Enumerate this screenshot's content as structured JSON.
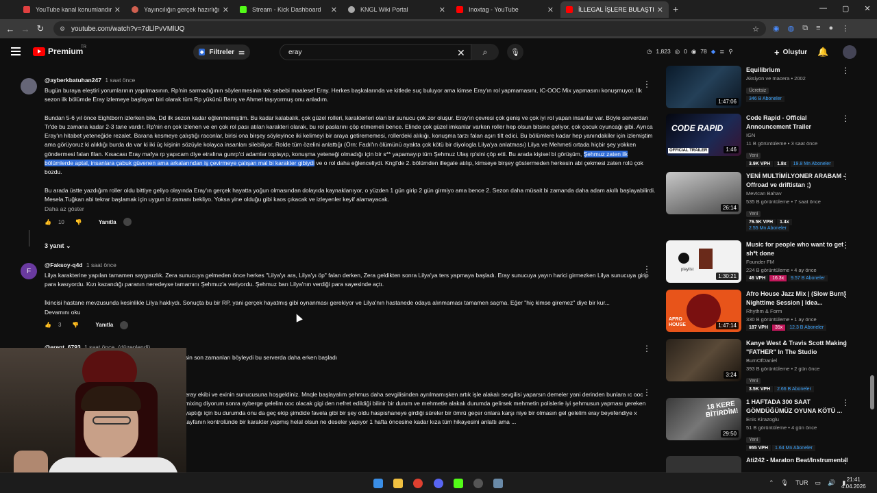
{
  "browser": {
    "tabs": [
      {
        "title": "YouTube kanal konumlandırma",
        "color": "#e04040"
      },
      {
        "title": "Yayıncılığın gerçek hazırlığı - Cl",
        "color": "#d06050"
      },
      {
        "title": "Stream - Kick Dashboard",
        "color": "#53fc18"
      },
      {
        "title": "KNGL Wiki Portal",
        "color": "#aaaaaa"
      },
      {
        "title": "Inoxtag - YouTube",
        "color": "#ff0000"
      },
      {
        "title": "İLLEGAL İŞLERE BULAŞTIK! POLİ",
        "color": "#ff0000"
      }
    ],
    "url": "youtube.com/watch?v=7dLlPvVMlUQ"
  },
  "header": {
    "logo": "Premium",
    "region": "TR",
    "filters_label": "Filtreler",
    "search_value": "eray",
    "stats": [
      "1,823",
      "0",
      "78"
    ],
    "create_label": "Oluştur"
  },
  "comments": [
    {
      "avatar": "",
      "author": "@ayberkbatuhan247",
      "time": "1 saat önce",
      "p1": "Bugün buraya eleştiri yorumlarının yapılmasının, Rp'nin sarmadığının söylenmesinin tek sebebi maalesef Eray. Herkes başkalarında ve kitlede suç buluyor ama kimse Eray'ın rol yapmamasını, IC-OOC Mix yapmasını konuşmuyor. İlk sezon ilk bölümde Eray izlemeye başlayan biri olarak tüm Rp yükünü Barış ve Ahmet taşıyormuş onu anladım.",
      "p2a": "Bundan 5-6 yıl önce Eightborn izlerken bile, Dd ilk sezon kadar eğlenmemiştim. Bu kadar kalabalık, çok güzel rolleri, karakterleri olan bir sunucu çok zor oluşur. Eray'ın çevresi çok geniş ve çok iyi rol yapan insanlar var. Böyle serverdan Tr'de bu zamana kadar 2-3 tane vardır. Rp'nin en çok izlenen ve en çok rol pası atılan karakteri olarak, bu rol paslarını çöp etmemeli bence. Elinde çok güzel imkanlar varken roller hep olsun bitsine geliyor, çok çocuk oyuncağı gibi. Ayrıca Eray'ın hitabet yeteneğide rezalet. Barana kesmeye çalıştığı raconlar, birisi ona birşey söyleyince iki kelimeyi bir araya getirememesi, rollerdeki alıkığı, konuşma tarzı falan aşırı tilt edici. Bu bölümlere kadar hep yanındakiler için izlemiştim ama görüyoruz ki alıklığı burda da var ki iki üç kişinin sözüyle kolayca insanları silebiliyor. Rolde tüm özelini anlattığı (Örn: Fadıl'ın ölümünü ayakta çok kötü bir diyologla Lilya'ya anlatması) Lilya ve Mehmeti ortada hiçbir şey yokken göndermesi falan filan. Kısacası Eray mafya rp yapıcam diye etrafına gunrp'ci adamlar toplayıp, konuşma yeteneği olmadığı için bir s** yapamayıp tüm Şehmuz Ulaş rp'sini çöp etti. Bu arada kişisel bi görüşüm, ",
      "p2hl": "Şehmuz zaten ilk bölümlerde aptal, insanlara çabuk güvenen ama arkalarından iş çevirmeye çalışan mal bi karakter gibiydi",
      "p2b": " ve o rol daha eğlenceliydi. Kngl'de 2. bölümden illegale atılıp, kimseye birşey göstermeden herkesin abi çekmesi zaten rolü çok bozdu.",
      "p3": "Bu arada üstte yazdığım roller oldu bittiye geliyo olayında Eray'ın gerçek hayatta yoğun olmasından dolayıda kaynaklanıyor, o yüzden 1 gün girip 2 gün girmiyo ama bence 2. Sezon daha müsait bi zamanda daha adam akıllı başlayabilirdi. Mesela.Tuğkan abi tekrar başlamak için uygun bi zamanı bekliyo. Yoksa yine olduğu gibi kaos çıkacak ve izleyenler keyif alamayacak.",
      "more": "Daha az göster",
      "likes": "10",
      "reply": "Yanıtla",
      "replies": "3 yanıt"
    },
    {
      "avatar": "F",
      "author": "@Faksoy-q4d",
      "time": "1 saat önce",
      "p1": "Lilya karakterine yapılan tamamen saygısızlık. Zera sunucuya gelmeden önce herkes \"Lilya'yı ara, Lilya'yı öp\" falan derken, Zera geldikten sonra Lilya'ya ters yapmaya başladı. Eray sunucuya yayın harici girmezken Lilya sunucuya girip para kasıyordu. Kızı kazandığı paranın neredeyse tamamını Şehmuz'a veriyordu. Şehmuz barı Lilya'nın verdiği para sayesinde açtı.",
      "p2": "İkincisi hastane mevzusunda kesinlikle Lilya haklıydı. Sonuçta bu bir RP, yani gerçek hayatmış gibi oynanması gerekiyor ve Lilya'nın hastanede odaya alınmaması tamamen saçma. Eğer \"hiç kimse giremez\" diye bir kur...",
      "more": "Devamını oku",
      "likes": "3",
      "reply": "Yanıtla"
    },
    {
      "author": "@erent_6793",
      "time": "1 saat önce",
      "edited": "(düzenlendi)",
      "text": "sin son zamanları böyleydi bu serverda daha erken başladı"
    },
    {
      "text": "eray ekibi ve exinin sunucusuna hoşgeldiniz. Mnqle başlayalım şehmus daha sevgilisinden ayrılmamışken artık işle alakalı sevgilisi yaparsın demeler yani derinden bunlara ıc ooc mixing diyorum sonra ayberge gelelim ooc olacak gigi den nefret edildiği bilinir bir durum ve mehmetle alakalı durumda gelirsek mehmetin polislerle iyi şehmusun yapması gereken yaptığı için bu durumda onu da geç ekip şimdide favela gibi bir şey oldu haspishaneye girdiği süreler bir ömrü geçer onlara karşı niye bir olmasın gel gelelim eray beyefendiye x tayfanın kontrolünde bir karakter yapmış helal olsun ne deseler yapıyor 1 hafta öncesine kadar kıza tüm hikayesini anlattı ama ..."
    }
  ],
  "sidebar": [
    {
      "title": "Equilibrium",
      "line1": "Aksiyon ve macera • 2002",
      "badge": "Ücretsiz",
      "subs": "346 B Aboneler",
      "duration": "1:47:06"
    },
    {
      "title": "Code Rapid - Official Announcement Trailer",
      "channel": "IGN",
      "views": "11 B görüntüleme • 3 saat önce",
      "badge": "Yeni",
      "vph": "3.9K VPH",
      "mult": "1.8x",
      "subs": "19.8 Mn Aboneler",
      "duration": "1:46",
      "thumbtext": "CODE RAPID",
      "thumbtag": "OFFICIAL TRAILER"
    },
    {
      "title": "YENİ MULTİMİLYONER ARABAM - Offroad ve driftistan ;)",
      "channel": "Mevtcan Bahav",
      "views": "535 B görüntüleme • 7 saat önce",
      "badge": "Yeni",
      "vph": "76.5K VPH",
      "mult": "1.4x",
      "subs": "2.55 Mn Aboneler",
      "duration": "26:14"
    },
    {
      "title": "Music for people who want to get sh*t done",
      "channel": "Founder FM",
      "views": "224 B görüntüleme • 4 ay önce",
      "vph": "46 VPH",
      "mult": "16.3x",
      "subs": "9.57 B Aboneler",
      "duration": "1:30:21",
      "thumbtext": "playlist"
    },
    {
      "title": "Afro House Jazz Mix | (Slow Burn) Nighttime Session | Idea...",
      "channel": "Rhythm & Form",
      "views": "330 B görüntüleme • 1 ay önce",
      "vph": "187 VPH",
      "mult": "35x",
      "subs": "12.3 B Aboneler",
      "duration": "1:47:14",
      "thumbtext": "AFRO HOUSE"
    },
    {
      "title": "Kanye West & Travis Scott Making \"FATHER\" In The Studio",
      "channel": "BurnOfDaniel",
      "views": "393 B görüntüleme • 2 gün önce",
      "badge": "Yeni",
      "vph": "3.5K VPH",
      "subs": "2.66 B Aboneler",
      "duration": "3:24"
    },
    {
      "title": "1 HAFTADA 300 SAAT GÖMDÜĞÜMÜZ OYUNA KÖTÜ ...",
      "channel": "Enis Kirazoglu",
      "views": "51 B görüntüleme • 4 gün önce",
      "badge": "Yeni",
      "vph": "955 VPH",
      "subs": "1.64 Mn Aboneler",
      "duration": "29:50",
      "thumbtext": "18 KERE BİTİRDİM!"
    },
    {
      "title": "Ati242 - Maraton Beat/Instrumental"
    }
  ],
  "taskbar": {
    "lang": "TUR",
    "time": "21:41",
    "date": "4.04.2026"
  }
}
